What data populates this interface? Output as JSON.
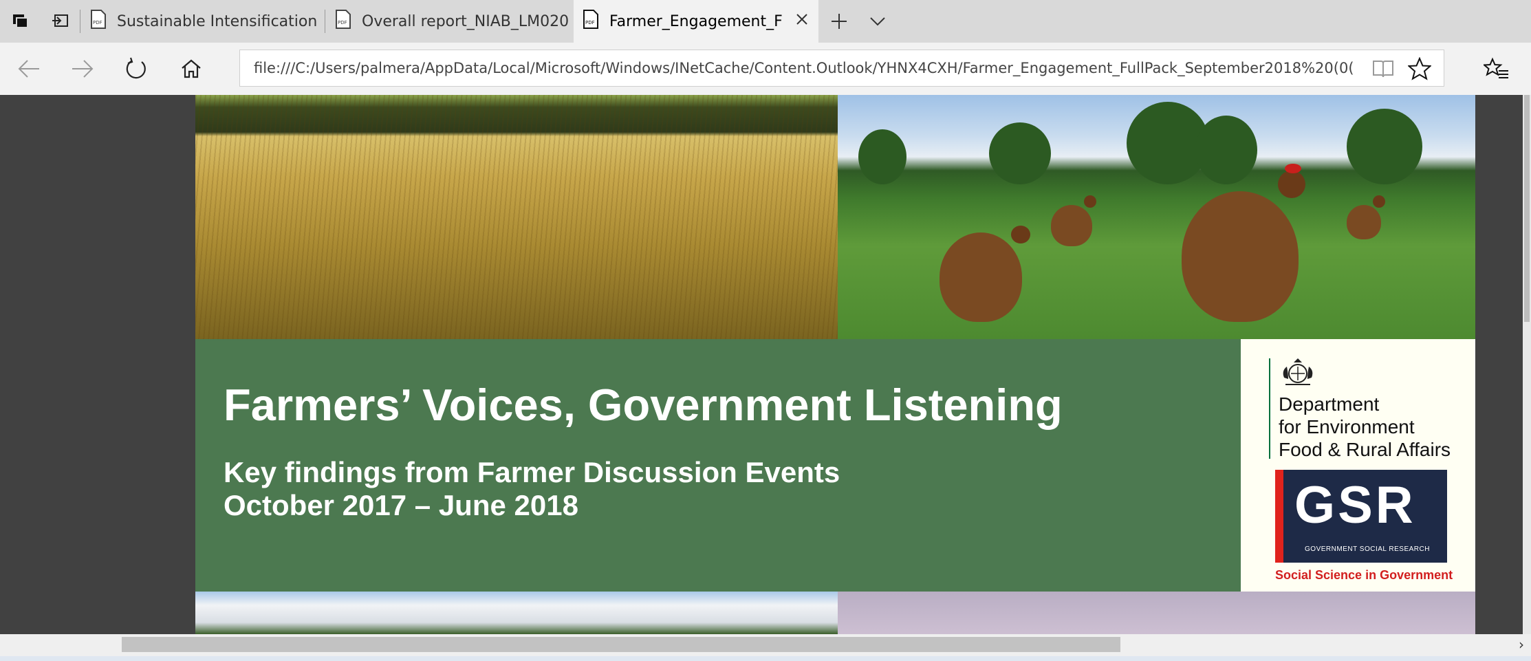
{
  "tabs": [
    {
      "label": "Sustainable Intensification i",
      "icon": "pdf-file-icon",
      "active": false
    },
    {
      "label": "Overall report_NIAB_LM020",
      "icon": "pdf-file-icon",
      "active": false
    },
    {
      "label": "Farmer_Engagement_Fu",
      "icon": "pdf-file-icon",
      "active": true
    }
  ],
  "toolbar": {
    "tab_actions_icon": "tabs-aside-icon",
    "back_icon": "back-arrow-icon",
    "forward_icon": "forward-arrow-icon",
    "refresh_icon": "refresh-icon",
    "home_icon": "home-icon",
    "new_tab_icon": "plus-icon",
    "tab_list_icon": "chevron-down-icon"
  },
  "address": {
    "url": "file:///C:/Users/palmera/AppData/Local/Microsoft/Windows/INetCache/Content.Outlook/YHNX4CXH/Farmer_Engagement_FullPack_September2018%20(0("
  },
  "document": {
    "title": "Farmers’ Voices, Government Listening",
    "subtitle_line1": "Key findings from Farmer Discussion Events",
    "subtitle_line2": "October 2017 – June 2018",
    "defra": {
      "line1": "Department",
      "line2": "for Environment",
      "line3": "Food & Rural Affairs"
    },
    "gsr": {
      "letters": "GSR",
      "small": "GOVERNMENT SOCIAL RESEARCH",
      "tagline": "Social Science in Government"
    }
  },
  "colors": {
    "banner_green": "#4c7950",
    "logo_panel": "#fffff3",
    "gsr_navy": "#1e2a47",
    "gsr_red": "#e0231c"
  }
}
